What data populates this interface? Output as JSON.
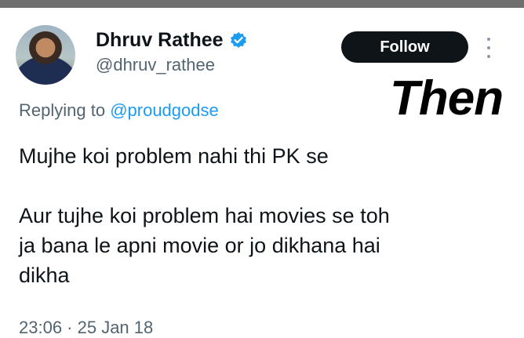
{
  "tweet": {
    "author_name": "Dhruv Rathee",
    "author_handle": "@dhruv_rathee",
    "follow_label": "Follow",
    "replying_prefix": "Replying to ",
    "replying_to": "@proudgodse",
    "text_line1": "Mujhe koi problem nahi thi PK se",
    "text_line2": "Aur tujhe koi problem hai movies se toh",
    "text_line3": "ja bana le apni movie or jo dikhana hai",
    "text_line4": "dikha",
    "timestamp": "23:06 · 25 Jan 18"
  },
  "overlay": {
    "label": "Then"
  },
  "icons": {
    "verified": "verified-badge-icon",
    "more": "more-options-icon"
  },
  "colors": {
    "follow_bg": "#0f1419",
    "link": "#1d9bf0",
    "muted": "#536471",
    "verified": "#1d9bf0"
  }
}
